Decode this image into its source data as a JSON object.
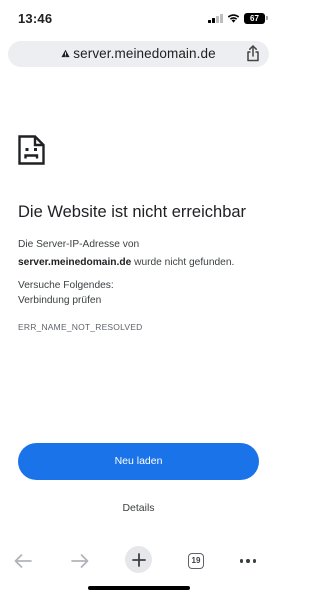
{
  "status_bar": {
    "time": "13:46",
    "battery_level": "67",
    "icons": [
      "signal-icon",
      "wifi-icon",
      "battery-icon"
    ]
  },
  "url_bar": {
    "url": "server.meinedomain.de",
    "lock_icon": "lock-warning-icon",
    "share_icon": "share-icon"
  },
  "error": {
    "icon": "sad-page-icon",
    "title": "Die Website ist nicht erreichbar",
    "desc_prefix": "Die Server-IP-Adresse von",
    "domain": "server.meinedomain.de",
    "desc_suffix": " wurde nicht gefunden.",
    "suggestions_heading": "Versuche Folgendes:",
    "suggestions": [
      "Verbindung prüfen"
    ],
    "code": "ERR_NAME_NOT_RESOLVED"
  },
  "actions": {
    "reload_label": "Neu laden",
    "details_label": "Details"
  },
  "toolbar": {
    "tab_count": "19",
    "items": [
      "back-icon",
      "forward-icon",
      "new-tab-icon",
      "tabs-icon",
      "menu-icon"
    ]
  },
  "colors": {
    "accent": "#1a73e8",
    "url_bar_bg": "#eceef1",
    "text_primary": "#202124",
    "text_secondary": "#3c4043"
  }
}
